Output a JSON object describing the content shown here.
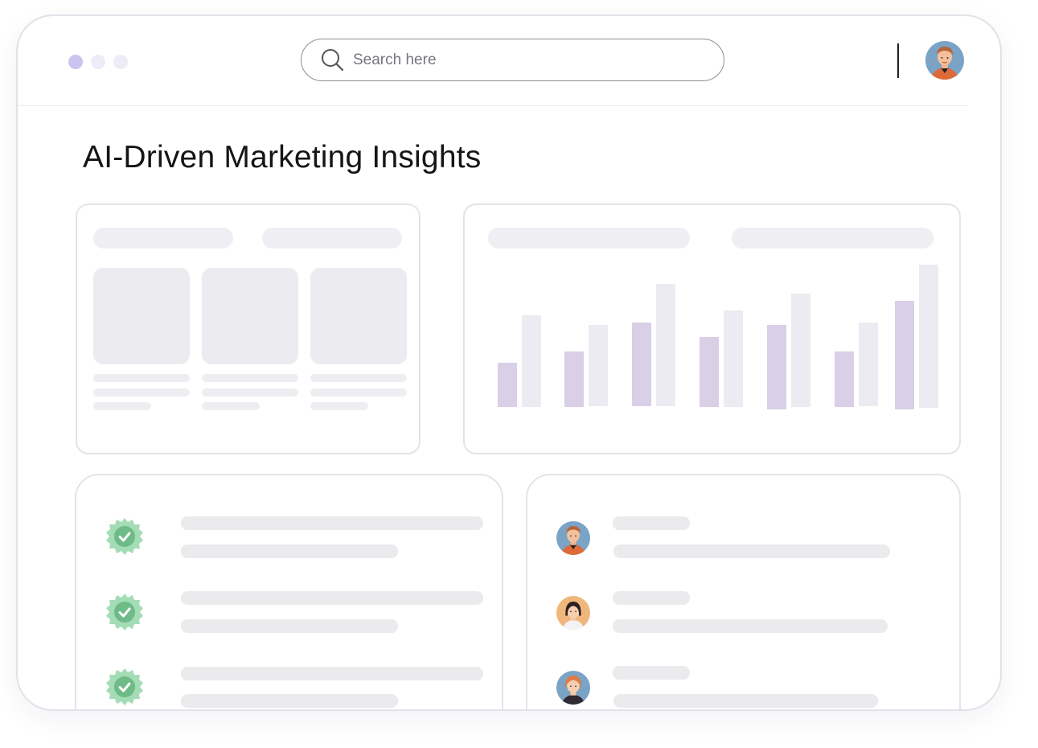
{
  "search": {
    "placeholder": "Search here"
  },
  "page": {
    "title": "AI-Driven Marketing Insights"
  },
  "colors": {
    "accent": "#c9c5ee",
    "bar_primary": "#d9cfe6",
    "bar_secondary": "#ecebf2",
    "check_badge": "#8ed1a5"
  },
  "icons": {
    "search": "search-icon",
    "check": "verified-check-icon",
    "avatar": "user-avatar"
  }
}
